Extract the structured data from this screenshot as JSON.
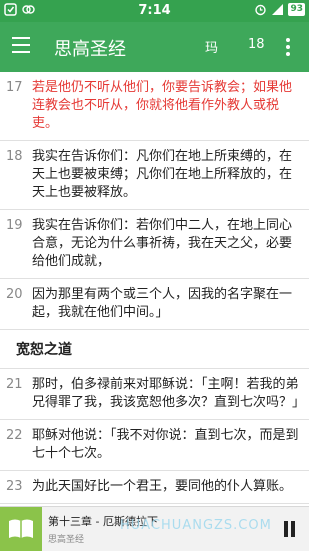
{
  "status_bar": {
    "time": "7:14",
    "battery": "93"
  },
  "app_bar": {
    "title": "思高圣经",
    "font_button": "玛",
    "size_button": "18"
  },
  "verses_top": [
    {
      "num": "17",
      "text": "若是他仍不听从他们，你要告诉教会；如果他连教会也不听从，你就将他看作外教人或税吏。",
      "highlighted": true
    },
    {
      "num": "18",
      "text": "我实在告诉你们：凡你们在地上所束缚的，在天上也要被束缚；凡你们在地上所释放的，在天上也要被释放。",
      "highlighted": false
    },
    {
      "num": "19",
      "text": "我实在告诉你们：若你们中二人，在地上同心合意，无论为什么事祈祷，我在天之父，必要给他们成就，",
      "highlighted": false
    },
    {
      "num": "20",
      "text": "因为那里有两个或三个人，因我的名字聚在一起，我就在他们中间。」",
      "highlighted": false
    }
  ],
  "section_heading": "宽恕之道",
  "verses_bottom": [
    {
      "num": "21",
      "text": "那时，伯多禄前来对耶稣说：「主啊！若我的弟兄得罪了我，我该宽恕他多次？直到七次吗？」",
      "highlighted": false
    },
    {
      "num": "22",
      "text": "耶稣对他说：「我不对你说：直到七次，而是到七十个七次。",
      "highlighted": false
    },
    {
      "num": "23",
      "text": "为此天国好比一个君王，要同他的仆人算账。",
      "highlighted": false
    }
  ],
  "player": {
    "chapter": "第十三章 - 厄斯德拉下",
    "subtitle": "思高圣经",
    "watermark": "HUACHUANGZS.COM"
  },
  "colors": {
    "status_bar": "#35a24f",
    "app_bar": "#3ea85a",
    "highlight_text": "#e53935"
  }
}
